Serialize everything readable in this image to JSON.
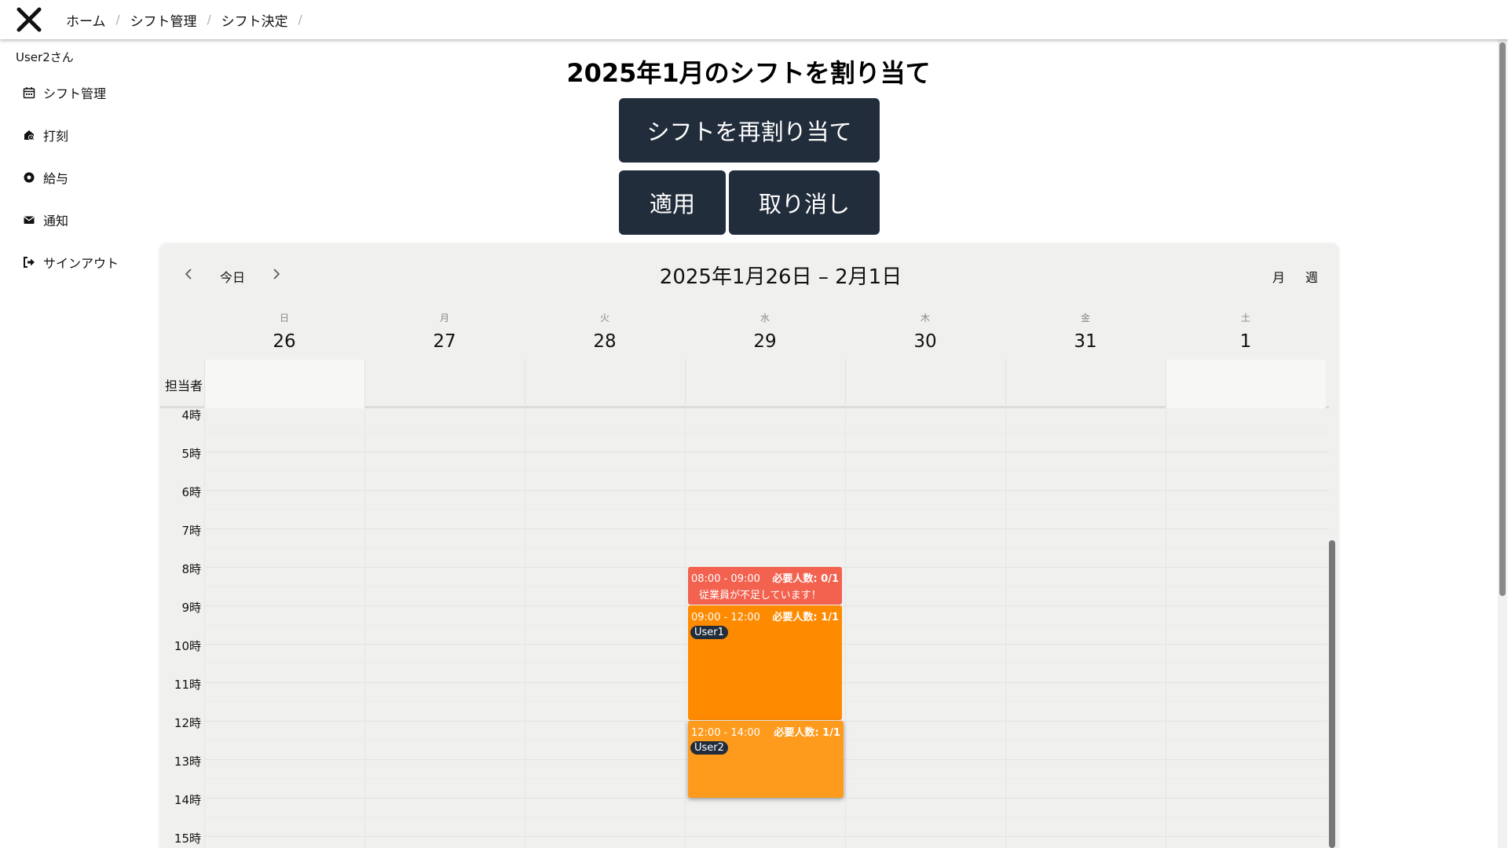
{
  "topbar": {
    "logo_icon": "x-close-icon",
    "breadcrumb": [
      "ホーム",
      "シフト管理",
      "シフト決定"
    ],
    "separator": "/"
  },
  "sidebar": {
    "username": "User2さん",
    "items": [
      {
        "label": "シフト管理",
        "icon": "calendar-icon"
      },
      {
        "label": "打刻",
        "icon": "punch-clock-icon"
      },
      {
        "label": "給与",
        "icon": "yen-coin-icon"
      },
      {
        "label": "通知",
        "icon": "mail-icon"
      },
      {
        "label": "サインアウト",
        "icon": "sign-out-icon"
      }
    ]
  },
  "main": {
    "title": "2025年1月のシフトを割り当て",
    "buttons": {
      "reassign": "シフトを再割り当て",
      "apply": "適用",
      "cancel": "取り消し"
    }
  },
  "calendar": {
    "nav": {
      "today": "今日",
      "range": "2025年1月26日 – 2月1日",
      "view_month": "月",
      "view_week": "週"
    },
    "days": [
      {
        "weekday": "日",
        "date": "26"
      },
      {
        "weekday": "月",
        "date": "27"
      },
      {
        "weekday": "火",
        "date": "28"
      },
      {
        "weekday": "水",
        "date": "29"
      },
      {
        "weekday": "木",
        "date": "30"
      },
      {
        "weekday": "金",
        "date": "31"
      },
      {
        "weekday": "土",
        "date": "1"
      }
    ],
    "allday_label": "担当者",
    "hours": [
      "4時",
      "5時",
      "6時",
      "7時",
      "8時",
      "9時",
      "10時",
      "11時",
      "12時",
      "13時",
      "14時",
      "15時"
    ],
    "events": [
      {
        "time": "08:00 - 09:00",
        "need": "必要人数: 0/1",
        "warning": "従業員が不足しています！",
        "color": "#f2624f"
      },
      {
        "time": "09:00 - 12:00",
        "need": "必要人数: 1/1",
        "user": "User1",
        "color": "#fe8a00"
      },
      {
        "time": "12:00 - 14:00",
        "need": "必要人数: 1/1",
        "user": "User2",
        "color": "#fe9a1c"
      }
    ]
  },
  "colors": {
    "dark_button": "#222d3c",
    "calendar_bg": "#f0f0ee",
    "shortage": "#f2624f",
    "assigned": "#fe8a00"
  }
}
